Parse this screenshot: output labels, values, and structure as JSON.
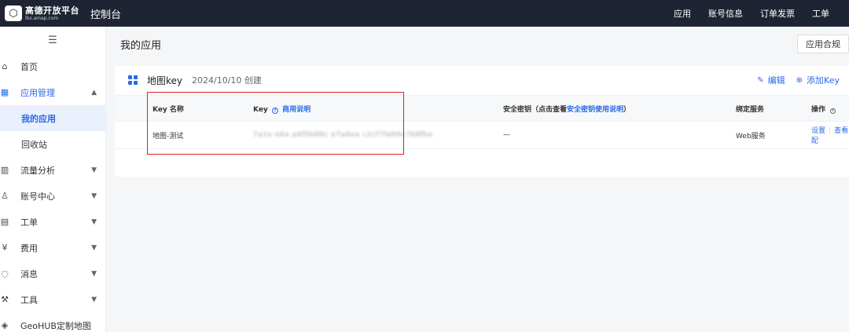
{
  "topbar": {
    "logo_name": "高德开放平台",
    "logo_url": "lbs.amap.com",
    "console_title": "控制台",
    "nav": [
      "应用",
      "账号信息",
      "订单发票",
      "工单"
    ]
  },
  "sidebar": {
    "collapse_icon": "hamburger-icon",
    "items": [
      {
        "label": "首页",
        "icon": "home-icon"
      },
      {
        "label": "应用管理",
        "icon": "apps-icon",
        "expanded": true,
        "children": [
          "我的应用",
          "回收站"
        ]
      },
      {
        "label": "流量分析",
        "icon": "chart-icon"
      },
      {
        "label": "账号中心",
        "icon": "user-icon"
      },
      {
        "label": "工单",
        "icon": "ticket-icon"
      },
      {
        "label": "费用",
        "icon": "currency-icon"
      },
      {
        "label": "消息",
        "icon": "message-icon"
      },
      {
        "label": "工具",
        "icon": "wrench-icon"
      },
      {
        "label": "GeoHUB定制地图",
        "icon": "layers-icon"
      }
    ]
  },
  "main": {
    "page_title": "我的应用",
    "compliance_button": "应用合规",
    "card": {
      "app_name": "地图key",
      "created": "2024/10/10 创建",
      "actions": {
        "edit": "编辑",
        "add_key": "添加Key"
      },
      "table": {
        "headers": {
          "key_name": "Key 名称",
          "key": "Key",
          "key_help": "商用说明",
          "secret": "安全密钥（点击查看",
          "secret_help": "安全密钥使用说明",
          "secret_close": "）",
          "service": "绑定服务",
          "ops": "操作"
        },
        "rows": [
          {
            "name": "地图-测试",
            "key": "7a1e e6a a4f0b86c e7a4ea c2cf7fa66e7b8fbe",
            "secret": "—",
            "service": "Web服务",
            "op_settings": "设置",
            "op_view": "查看配"
          }
        ]
      }
    }
  },
  "colors": {
    "topbar": "#1e2433",
    "accent": "#2a6ae9",
    "highlight": "#e02020"
  }
}
